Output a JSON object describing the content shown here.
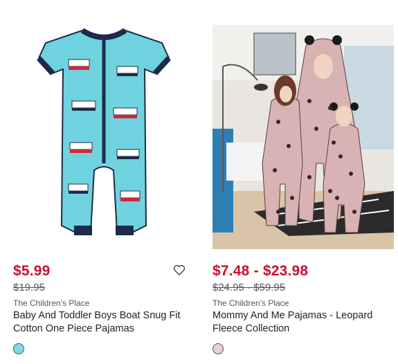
{
  "products": [
    {
      "price": "$5.99",
      "original_price": "$19.95",
      "brand": "The Children's Place",
      "title": "Baby And Toddler Boys Boat Snug Fit Cotton One Piece Pajamas",
      "swatch_color": "#7fd9e6",
      "wishlist_icon": "heart-outline-icon"
    },
    {
      "price": "$7.48 - $23.98",
      "original_price": "$24.95 - $59.95",
      "brand": "The Children's Place",
      "title": "Mommy And Me Pajamas - Leopard Fleece Collection",
      "swatch_color": "#e8cfd8"
    }
  ],
  "colors": {
    "sale_price": "#c8102e"
  }
}
